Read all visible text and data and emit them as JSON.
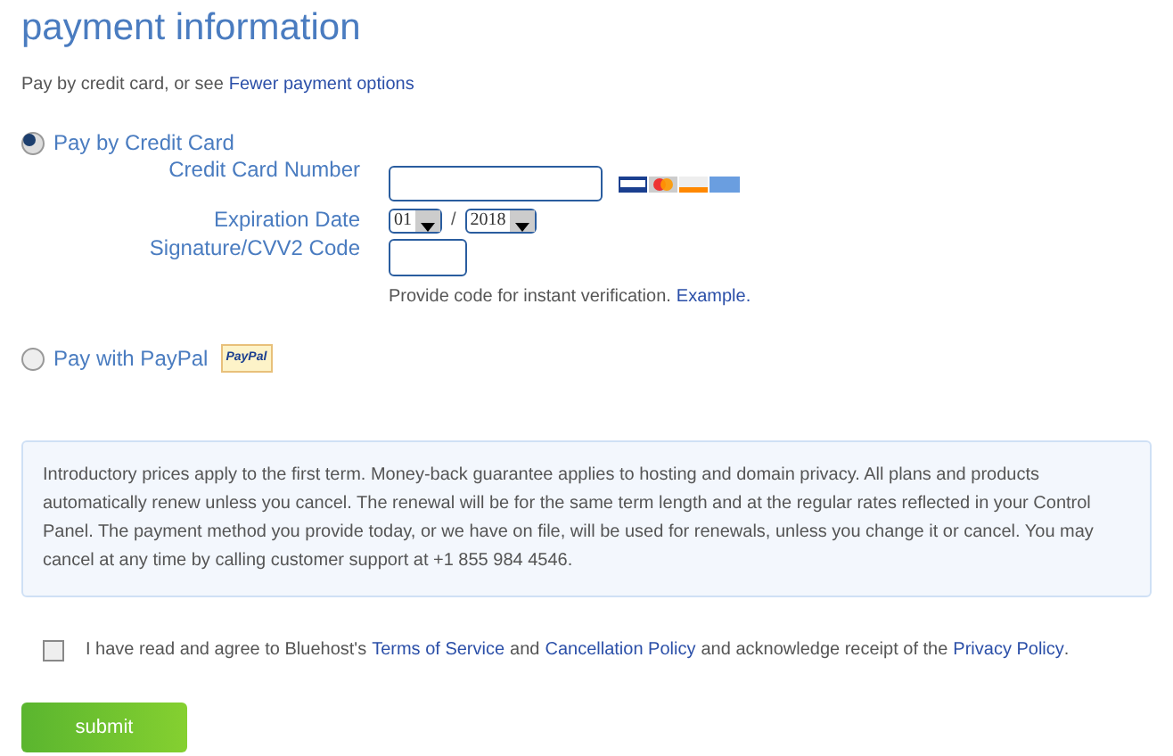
{
  "title": "payment information",
  "intro": {
    "text": "Pay by credit card, or see",
    "link": "Fewer payment options"
  },
  "methods": [
    {
      "label": "Pay by Credit Card",
      "selected": true,
      "kind": "card"
    },
    {
      "label": "Pay with PayPal",
      "selected": false,
      "kind": "paypal",
      "badge": "PayPal"
    }
  ],
  "card_form": {
    "number_label": "Credit Card Number",
    "expiry_label": "Expiration Date",
    "month": "01",
    "separator": "/",
    "year": "2018",
    "cvv_label": "Signature/CVV2 Code",
    "hint": "Provide code for instant verification.",
    "hint_link": "Example."
  },
  "notice": "Introductory prices apply to the first term. Money-back guarantee applies to hosting and domain privacy. All plans and products automatically renew unless you cancel. The renewal will be for the same term length and at the regular rates reflected in your Control Panel. The payment method you provide today, or we have on file, will be used for renewals, unless you change it or cancel. You may cancel at any time by calling customer support at +1 855 984 4546.",
  "agreement": {
    "checked": false,
    "parts": [
      {
        "kind": "text",
        "text": "I have read and agree to Bluehost's"
      },
      {
        "kind": "link",
        "text": "Terms of Service"
      },
      {
        "kind": "text",
        "text": "and"
      },
      {
        "kind": "link",
        "text": "Cancellation Policy"
      },
      {
        "kind": "text",
        "text": "and acknowledge receipt of the"
      },
      {
        "kind": "link",
        "text": "Privacy Policy"
      },
      {
        "kind": "text",
        "text": "."
      }
    ]
  },
  "submit": "submit"
}
